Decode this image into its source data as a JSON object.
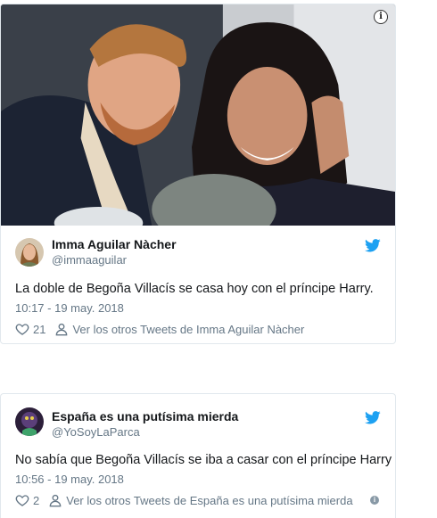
{
  "tweets": [
    {
      "name": "Imma Aguilar Nàcher",
      "handle": "@immaaguilar",
      "text": "La doble de Begoña Villacís se casa hoy con el príncipe Harry.",
      "time": "10:17 - 19 may. 2018",
      "likes": "21",
      "more_link": "Ver los otros Tweets de Imma Aguilar Nàcher",
      "info_glyph": "i"
    },
    {
      "name": "España es una putísima mierda",
      "handle": "@YoSoyLaParca",
      "text": "No sabía que Begoña Villacís se iba a casar con el príncipe Harry",
      "time": "10:56 - 19 may. 2018",
      "likes": "2",
      "more_link": "Ver los otros Tweets de España es una putísima mierda",
      "info_glyph": "i"
    }
  ],
  "icons": {
    "brand": "twitter-bird-icon",
    "like": "heart-icon",
    "profile": "person-icon",
    "info": "info-icon"
  },
  "colors": {
    "twitter_blue": "#1da1f2",
    "secondary_text": "#657786",
    "border": "#e1e8ed"
  }
}
